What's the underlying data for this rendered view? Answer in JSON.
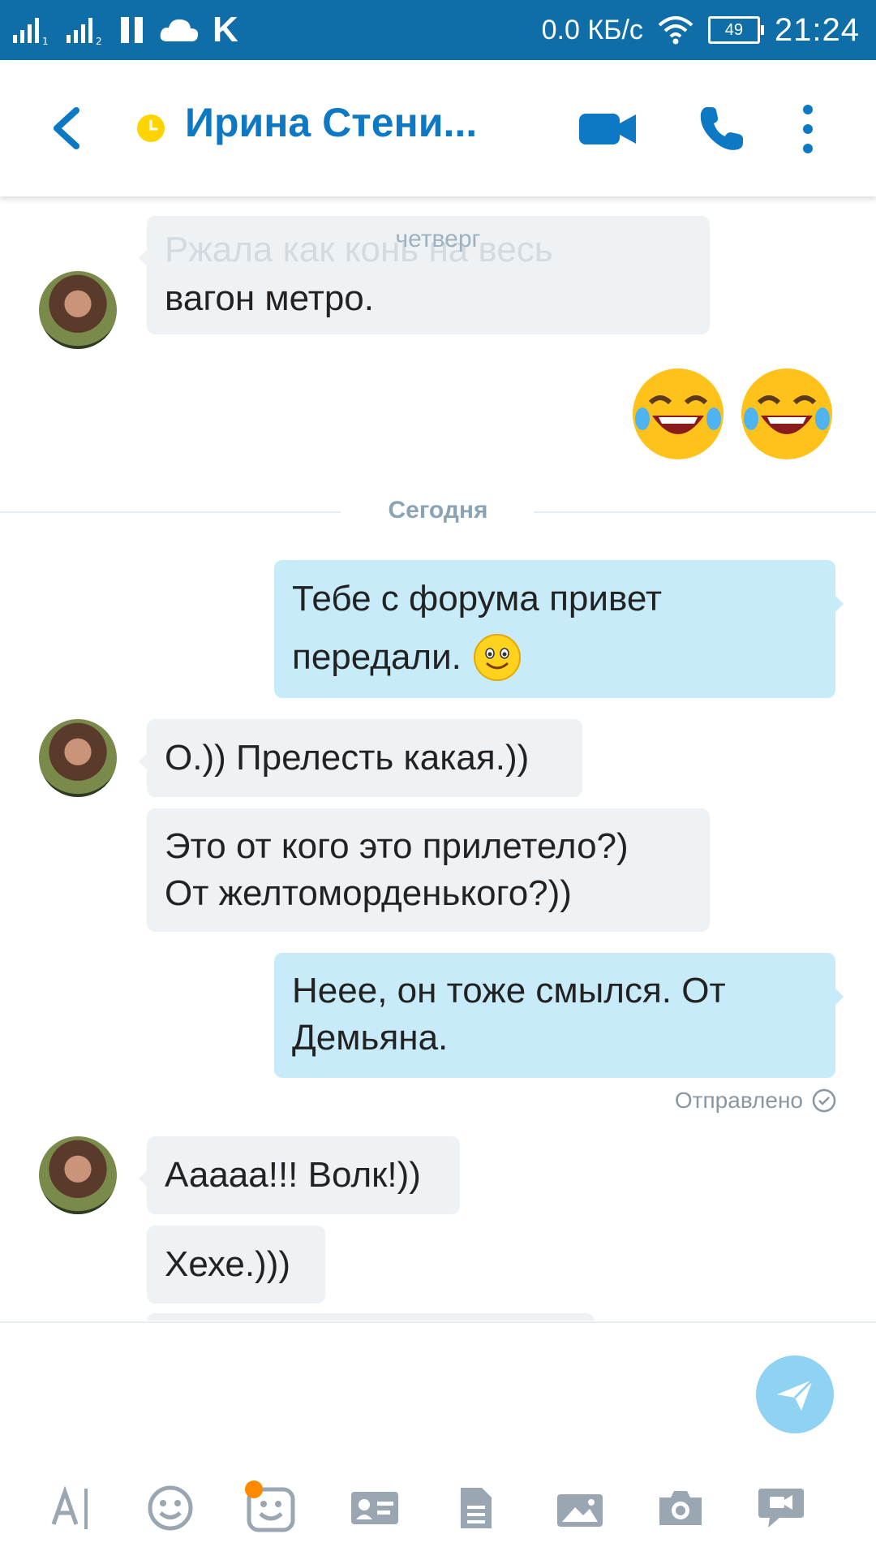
{
  "status_bar": {
    "network_speed": "0.0 КБ/с",
    "battery": "49",
    "time": "21:24",
    "app_icon_letter": "K"
  },
  "header": {
    "contact_name": "Ирина Стени...",
    "status_color": "#ffd400",
    "accent_color": "#0d79c4"
  },
  "chat": {
    "earlier_day": "четверг",
    "today_label": "Сегодня",
    "messages": [
      {
        "side": "in",
        "text_line1": "Ржала как конь на весь",
        "text_line2": "вагон метро."
      },
      {
        "side": "out",
        "emoji": [
          "tears-of-joy-emoji",
          "tears-of-joy-emoji"
        ]
      },
      {
        "side": "out",
        "text_line1": "Тебе с форума привет",
        "text_line2": "передали.",
        "emoji": "smile-emoji"
      },
      {
        "side": "in",
        "text_line1": "О.)) Прелесть какая.))"
      },
      {
        "side": "in",
        "text_line1": "Это от кого это прилетело?)",
        "text_line2": "От желтоморденького?))"
      },
      {
        "side": "out",
        "text_line1": "Неее, он тоже смылся. От",
        "text_line2": "Демьяна."
      },
      {
        "side": "in",
        "text_line1": "Ааааа!!! Волк!))"
      },
      {
        "side": "in",
        "text_line1": "Хехе.)))"
      }
    ],
    "sent_status": "Отправлено"
  },
  "toolbar": {
    "items": [
      "text-format-icon",
      "emoticon-icon",
      "mojis-icon",
      "contact-card-icon",
      "file-icon",
      "media-bar-icon",
      "camera-icon",
      "video-message-icon"
    ]
  }
}
